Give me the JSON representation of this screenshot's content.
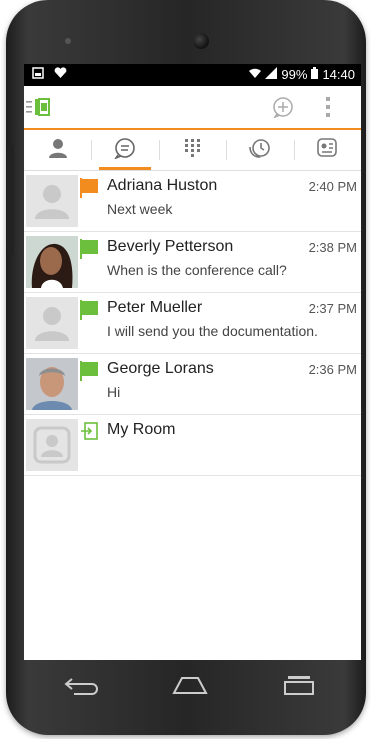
{
  "status_bar": {
    "battery": "99%",
    "time": "14:40"
  },
  "tabs": [
    "contacts-tab",
    "chats-tab",
    "dialpad-tab",
    "history-tab",
    "rooms-tab"
  ],
  "chats": [
    {
      "name": "Adriana Huston",
      "message": "Next week",
      "time": "2:40 PM",
      "flag_color": "#f28c1e",
      "avatar": "placeholder"
    },
    {
      "name": "Beverly Petterson",
      "message": "When is the conference call?",
      "time": "2:38 PM",
      "flag_color": "#6cbf3c",
      "avatar": "photo"
    },
    {
      "name": "Peter Mueller",
      "message": "I will send you the documentation.",
      "time": "2:37 PM",
      "flag_color": "#6cbf3c",
      "avatar": "placeholder"
    },
    {
      "name": "George Lorans",
      "message": "Hi",
      "time": "2:36 PM",
      "flag_color": "#6cbf3c",
      "avatar": "photo"
    },
    {
      "name": "My Room",
      "message": "",
      "time": "",
      "flag_color": "#6cbf3c",
      "avatar": "room"
    }
  ],
  "colors": {
    "accent": "#f28c1e",
    "green": "#6cbf3c"
  }
}
